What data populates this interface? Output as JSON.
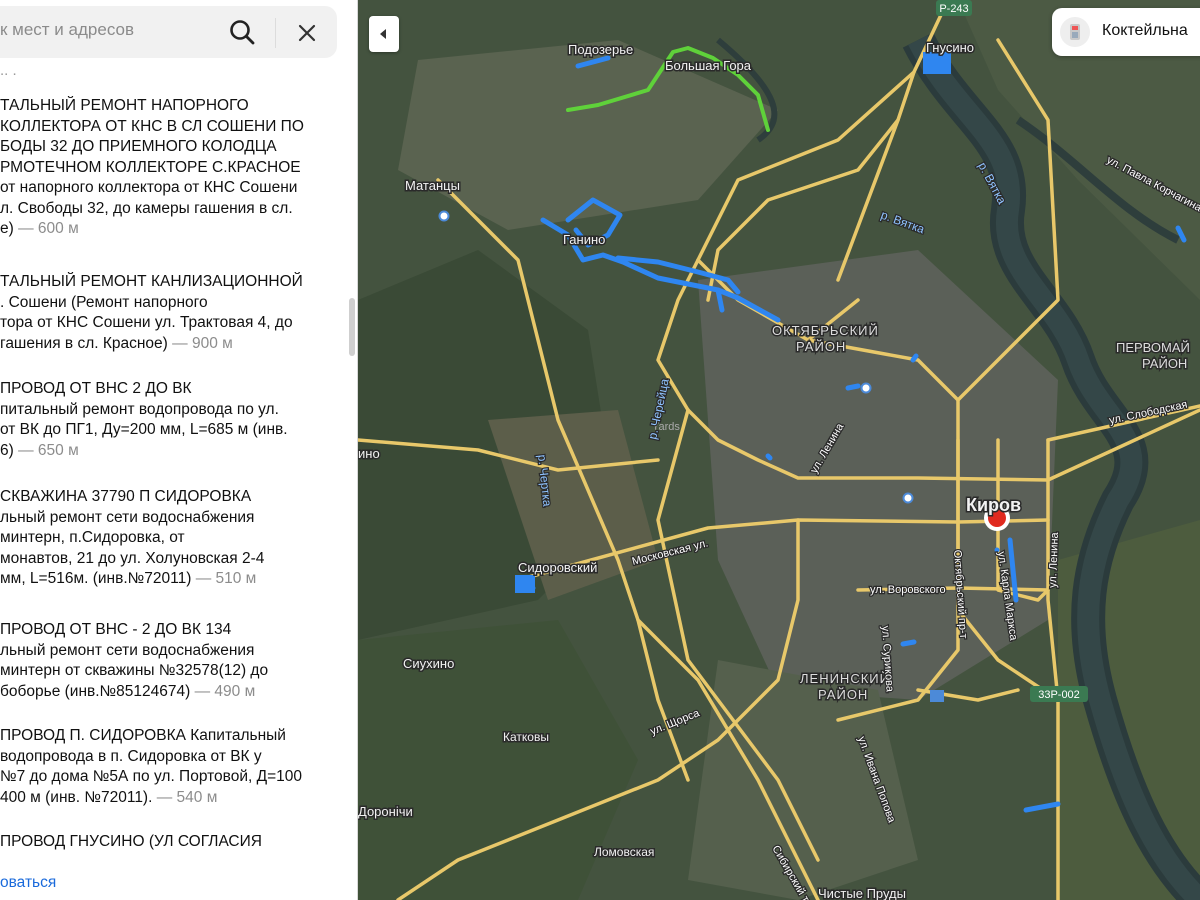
{
  "search": {
    "placeholder": "к мест и адресов",
    "search_icon": "search-icon",
    "close_icon": "close-icon"
  },
  "results": {
    "stub": "..  .",
    "items": [
      {
        "lines": [
          "ТАЛЬНЫЙ РЕМОНТ НАПОРНОГО",
          "КОЛЛЕКТОРА ОТ КНС В СЛ СОШЕНИ ПО",
          "БОДЫ 32 ДО ПРИЕМНОГО КОЛОДЦА",
          "РМОТЕЧНОМ КОЛЛЕКТОРЕ С.КРАСНОЕ",
          "от напорного коллектора от КНС Сошени",
          "л. Свободы 32, до камеры гашения в сл.",
          "е)"
        ],
        "distance": "— 600 м"
      },
      {
        "lines": [
          "ТАЛЬНЫЙ РЕМОНТ КАНЛИЗАЦИОННОЙ",
          ". Сошени (Ремонт напорного",
          "тора от КНС Сошени ул. Трактовая 4, до",
          "гашения в сл. Красное)"
        ],
        "distance": "— 900 м"
      },
      {
        "lines": [
          "ПРОВОД ОТ ВНС 2 ДО ВК",
          "питальный ремонт водопровода по ул.",
          "от ВК до ПГ1, Ду=200 мм, L=685 м (инв.",
          "6)"
        ],
        "distance": "— 650 м"
      },
      {
        "lines": [
          "СКВАЖИНА 37790 П СИДОРОВКА",
          "льный ремонт сети водоснабжения",
          "минтерн, п.Сидоровка, от",
          "монавтов, 21 до ул. Холуновская 2-4",
          "мм, L=516м. (инв.№72011)"
        ],
        "distance": "— 510 м"
      },
      {
        "lines": [
          "ПРОВОД ОТ ВНС - 2 ДО ВК 134",
          "льный ремонт сети водоснабжения",
          "минтерн от скважины №32578(12) до",
          "боборье (инв.№85124674)"
        ],
        "distance": "— 490 м"
      },
      {
        "lines": [
          "ПРОВОД П. СИДОРОВКА Капитальный",
          "водопровода в п. Сидоровка от ВК у",
          "№7 до дома №5А по ул. Портовой, Д=100",
          "400 м (инв. №72011)."
        ],
        "distance": "— 540 м"
      },
      {
        "lines": [
          "ПРОВОД ГНУСИНО (УЛ СОГЛАСИЯ"
        ],
        "distance": ""
      }
    ]
  },
  "footer": {
    "link": "оваться"
  },
  "map": {
    "collapse_icon": "chevron-left-icon",
    "chip": {
      "label": "Коктейльна",
      "icon": "place-icon"
    },
    "labels": {
      "podozerye": "Подозерье",
      "bolshaya_gora": "Большая Гора",
      "gnusino": "Гнусино",
      "matantsy": "Матанцы",
      "ganino": "Ганино",
      "oktyabrsky": "ОКТЯБРЬСКИЙ",
      "rayon1": "РАЙОН",
      "leninsky": "ЛЕНИНСКИЙ",
      "rayon2": "РАЙОН",
      "kirov": "Киров",
      "pervomai": "ПЕРВОМАЙ",
      "rayon3": "РАЙОН",
      "sidorovsky": "Сидоровский",
      "siukhino": "Сиухино",
      "katkovy": "Катковы",
      "doronichi": "Доронічи",
      "lomovskaya": "Ломовская",
      "chistye_prudy": "Чистые Пруды",
      "ino": "ино",
      "vyatka1": "р. Вятка",
      "vyatka2": "р. Вятка",
      "chertka": "р. Черейца",
      "chertka2": "р. Чертка",
      "r243": "Р-243",
      "r33": "33Р-002",
      "ul_korotkova": "ул. Павла Корчагина",
      "ul_slobodskaya": "ул. Слободская",
      "ul_lenina": "ул. Ленина",
      "ul_moskovskaya": "Московская ул.",
      "ul_vorovskogo": "ул. Воровского",
      "ul_shchorsa": "ул. Щорса",
      "ul_oktyabrsky": "Октябрьский пр-т",
      "ul_karla_marksa": "ул. Карла Маркса",
      "ul_lenina2": "ул. Ленина",
      "ul_burova": "ул. Сурикова",
      "ul_ivana_popova": "ул. Ивана Попова",
      "traktovaya": "Сибирский тракт",
      "yards": "Yards"
    },
    "colors": {
      "road": "#e8c86a",
      "pipe_blue": "#2f86f0",
      "pipe_green": "#5fd13a",
      "marker": "#e02a1f"
    }
  }
}
